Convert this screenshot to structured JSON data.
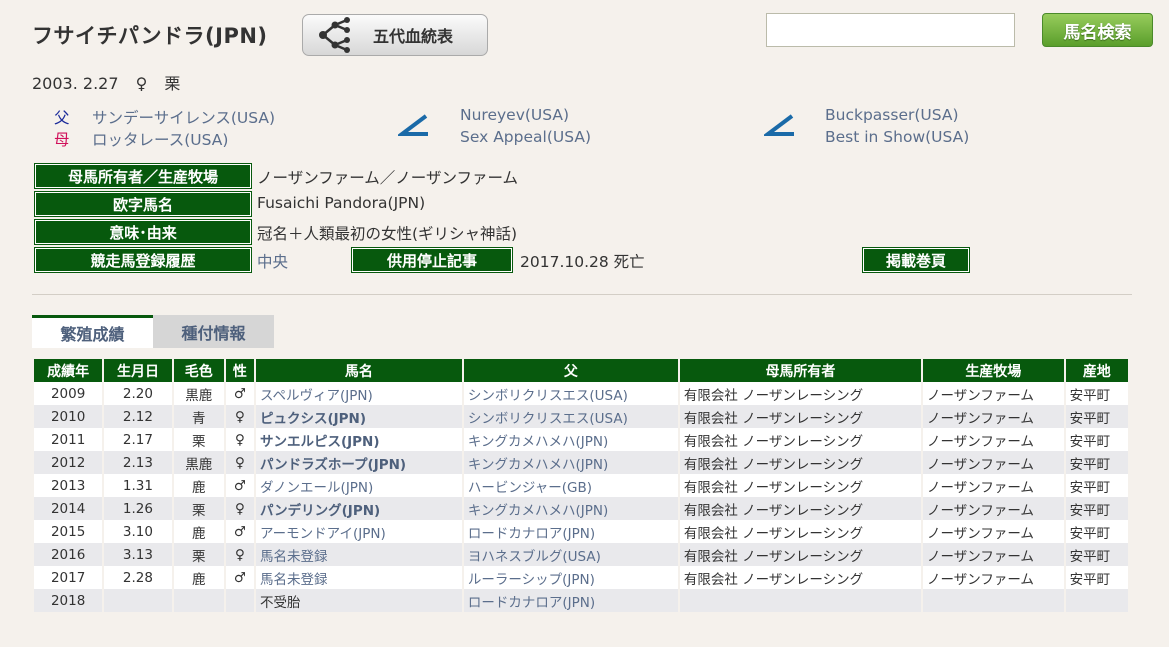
{
  "horse": {
    "name": "フサイチパンドラ(JPN)",
    "pedigree_button": "五代血統表",
    "birth_date": "2003. 2.27",
    "sex_symbol": "♀",
    "color": "栗"
  },
  "search": {
    "placeholder": "",
    "button": "馬名検索"
  },
  "pedigree": {
    "sire_label": "父",
    "dam_label": "母",
    "sire": "サンデーサイレンス(USA)",
    "dam": "ロッタレース(USA)",
    "dam_sire": "Nureyev(USA)",
    "dam_dam": "Sex Appeal(USA)",
    "dam_dam_sire": "Buckpasser(USA)",
    "dam_dam_dam": "Best in Show(USA)"
  },
  "info": {
    "owner_label": "母馬所有者／生産牧場",
    "owner_value": "ノーザンファーム／ノーザンファーム",
    "roman_label": "欧字馬名",
    "roman_value": "Fusaichi Pandora(JPN)",
    "meaning_label": "意味･由来",
    "meaning_value": "冠名＋人類最初の女性(ギリシャ神話)",
    "registry_label": "競走馬登録履歴",
    "registry_value": "中央",
    "retire_label": "供用停止記事",
    "retire_value": "2017.10.28 死亡",
    "page_label": "掲載巻頁"
  },
  "tabs": {
    "active": "繁殖成績",
    "inactive": "種付情報"
  },
  "table": {
    "headers": [
      "成績年",
      "生月日",
      "毛色",
      "性",
      "馬名",
      "父",
      "母馬所有者",
      "生産牧場",
      "産地"
    ],
    "rows": [
      {
        "year": "2009",
        "date": "2.20",
        "color": "黒鹿",
        "sex": "♂",
        "name": "スペルヴィア(JPN)",
        "bold": false,
        "sire": "シンボリクリスエス(USA)",
        "owner": "有限会社 ノーザンレーシング",
        "farm": "ノーザンファーム",
        "place": "安平町"
      },
      {
        "year": "2010",
        "date": "2.12",
        "color": "青",
        "sex": "♀",
        "name": "ピュクシス(JPN)",
        "bold": true,
        "sire": "シンボリクリスエス(USA)",
        "owner": "有限会社 ノーザンレーシング",
        "farm": "ノーザンファーム",
        "place": "安平町"
      },
      {
        "year": "2011",
        "date": "2.17",
        "color": "栗",
        "sex": "♀",
        "name": "サンエルピス(JPN)",
        "bold": true,
        "sire": "キングカメハメハ(JPN)",
        "owner": "有限会社 ノーザンレーシング",
        "farm": "ノーザンファーム",
        "place": "安平町"
      },
      {
        "year": "2012",
        "date": "2.13",
        "color": "黒鹿",
        "sex": "♀",
        "name": "パンドラズホープ(JPN)",
        "bold": true,
        "sire": "キングカメハメハ(JPN)",
        "owner": "有限会社 ノーザンレーシング",
        "farm": "ノーザンファーム",
        "place": "安平町"
      },
      {
        "year": "2013",
        "date": "1.31",
        "color": "鹿",
        "sex": "♂",
        "name": "ダノンエール(JPN)",
        "bold": false,
        "sire": "ハービンジャー(GB)",
        "owner": "有限会社 ノーザンレーシング",
        "farm": "ノーザンファーム",
        "place": "安平町"
      },
      {
        "year": "2014",
        "date": "1.26",
        "color": "栗",
        "sex": "♀",
        "name": "パンデリング(JPN)",
        "bold": true,
        "sire": "キングカメハメハ(JPN)",
        "owner": "有限会社 ノーザンレーシング",
        "farm": "ノーザンファーム",
        "place": "安平町"
      },
      {
        "year": "2015",
        "date": "3.10",
        "color": "鹿",
        "sex": "♂",
        "name": "アーモンドアイ(JPN)",
        "bold": false,
        "sire": "ロードカナロア(JPN)",
        "owner": "有限会社 ノーザンレーシング",
        "farm": "ノーザンファーム",
        "place": "安平町"
      },
      {
        "year": "2016",
        "date": "3.13",
        "color": "栗",
        "sex": "♀",
        "name": "馬名未登録",
        "bold": false,
        "sire": "ヨハネスブルグ(USA)",
        "owner": "有限会社 ノーザンレーシング",
        "farm": "ノーザンファーム",
        "place": "安平町"
      },
      {
        "year": "2017",
        "date": "2.28",
        "color": "鹿",
        "sex": "♂",
        "name": "馬名未登録",
        "bold": false,
        "sire": "ルーラーシップ(JPN)",
        "owner": "有限会社 ノーザンレーシング",
        "farm": "ノーザンファーム",
        "place": "安平町"
      },
      {
        "year": "2018",
        "date": "",
        "color": "",
        "sex": "",
        "name": "不受胎",
        "bold": false,
        "plain": true,
        "sire": "ロードカナロア(JPN)",
        "owner": "",
        "farm": "",
        "place": ""
      }
    ]
  }
}
